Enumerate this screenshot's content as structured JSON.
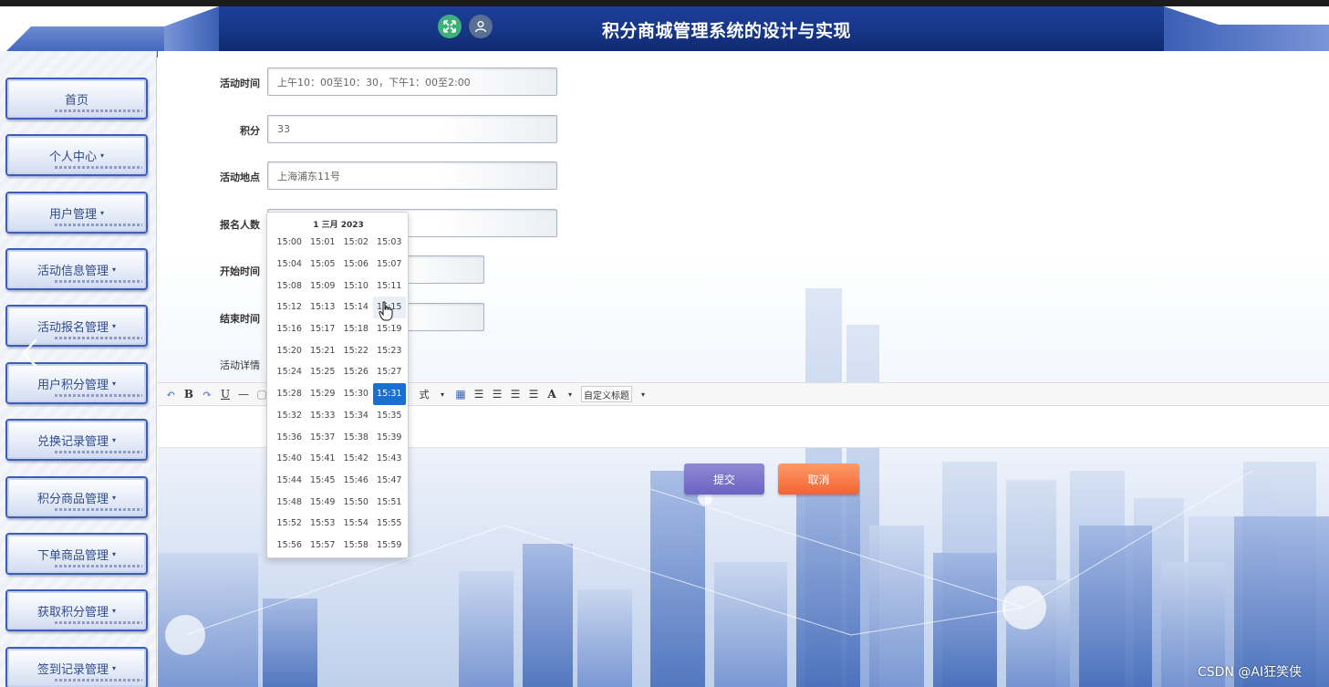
{
  "header": {
    "title": "积分商城管理系统的设计与实现",
    "icons": [
      "expand-icon",
      "user-icon"
    ],
    "colors": {
      "bar": "#163585",
      "wing": "#5a7cc8"
    }
  },
  "sidebar": {
    "items": [
      {
        "label": "首页",
        "has_caret": false
      },
      {
        "label": "个人中心",
        "has_caret": true
      },
      {
        "label": "用户管理",
        "has_caret": true
      },
      {
        "label": "活动信息管理",
        "has_caret": true
      },
      {
        "label": "活动报名管理",
        "has_caret": true
      },
      {
        "label": "用户积分管理",
        "has_caret": true
      },
      {
        "label": "兑换记录管理",
        "has_caret": true
      },
      {
        "label": "积分商品管理",
        "has_caret": true
      },
      {
        "label": "下单商品管理",
        "has_caret": true
      },
      {
        "label": "获取积分管理",
        "has_caret": true
      },
      {
        "label": "签到记录管理",
        "has_caret": true
      }
    ],
    "caret": "▾"
  },
  "form": {
    "activity_time": {
      "label": "活动时间",
      "value": "上午10：00至10：30，下午1：00至2:00"
    },
    "points": {
      "label": "积分",
      "value": "33"
    },
    "location": {
      "label": "活动地点",
      "value": "上海浦东11号"
    },
    "signup_count": {
      "label": "报名人数",
      "value": ""
    },
    "start_time": {
      "label": "开始时间",
      "value": ""
    },
    "end_time": {
      "label": "结束时间",
      "value": ""
    },
    "details": {
      "label": "活动详情"
    }
  },
  "editor_toolbar": {
    "bold": "B",
    "underline": "U",
    "style_fragment": "式",
    "font_color": "A",
    "custom_title": "自定义标题"
  },
  "buttons": {
    "submit": "提交",
    "cancel": "取消"
  },
  "time_picker": {
    "title": "1 三月 2023",
    "selected": "15:31",
    "hovered": "15:15",
    "times": [
      "15:00",
      "15:01",
      "15:02",
      "15:03",
      "15:04",
      "15:05",
      "15:06",
      "15:07",
      "15:08",
      "15:09",
      "15:10",
      "15:11",
      "15:12",
      "15:13",
      "15:14",
      "15:15",
      "15:16",
      "15:17",
      "15:18",
      "15:19",
      "15:20",
      "15:21",
      "15:22",
      "15:23",
      "15:24",
      "15:25",
      "15:26",
      "15:27",
      "15:28",
      "15:29",
      "15:30",
      "15:31",
      "15:32",
      "15:33",
      "15:34",
      "15:35",
      "15:36",
      "15:37",
      "15:38",
      "15:39",
      "15:40",
      "15:41",
      "15:42",
      "15:43",
      "15:44",
      "15:45",
      "15:46",
      "15:47",
      "15:48",
      "15:49",
      "15:50",
      "15:51",
      "15:52",
      "15:53",
      "15:54",
      "15:55",
      "15:56",
      "15:57",
      "15:58",
      "15:59"
    ],
    "colors": {
      "selected": "#1a6fd1"
    }
  },
  "watermark": "CSDN @AI狂笑侠"
}
